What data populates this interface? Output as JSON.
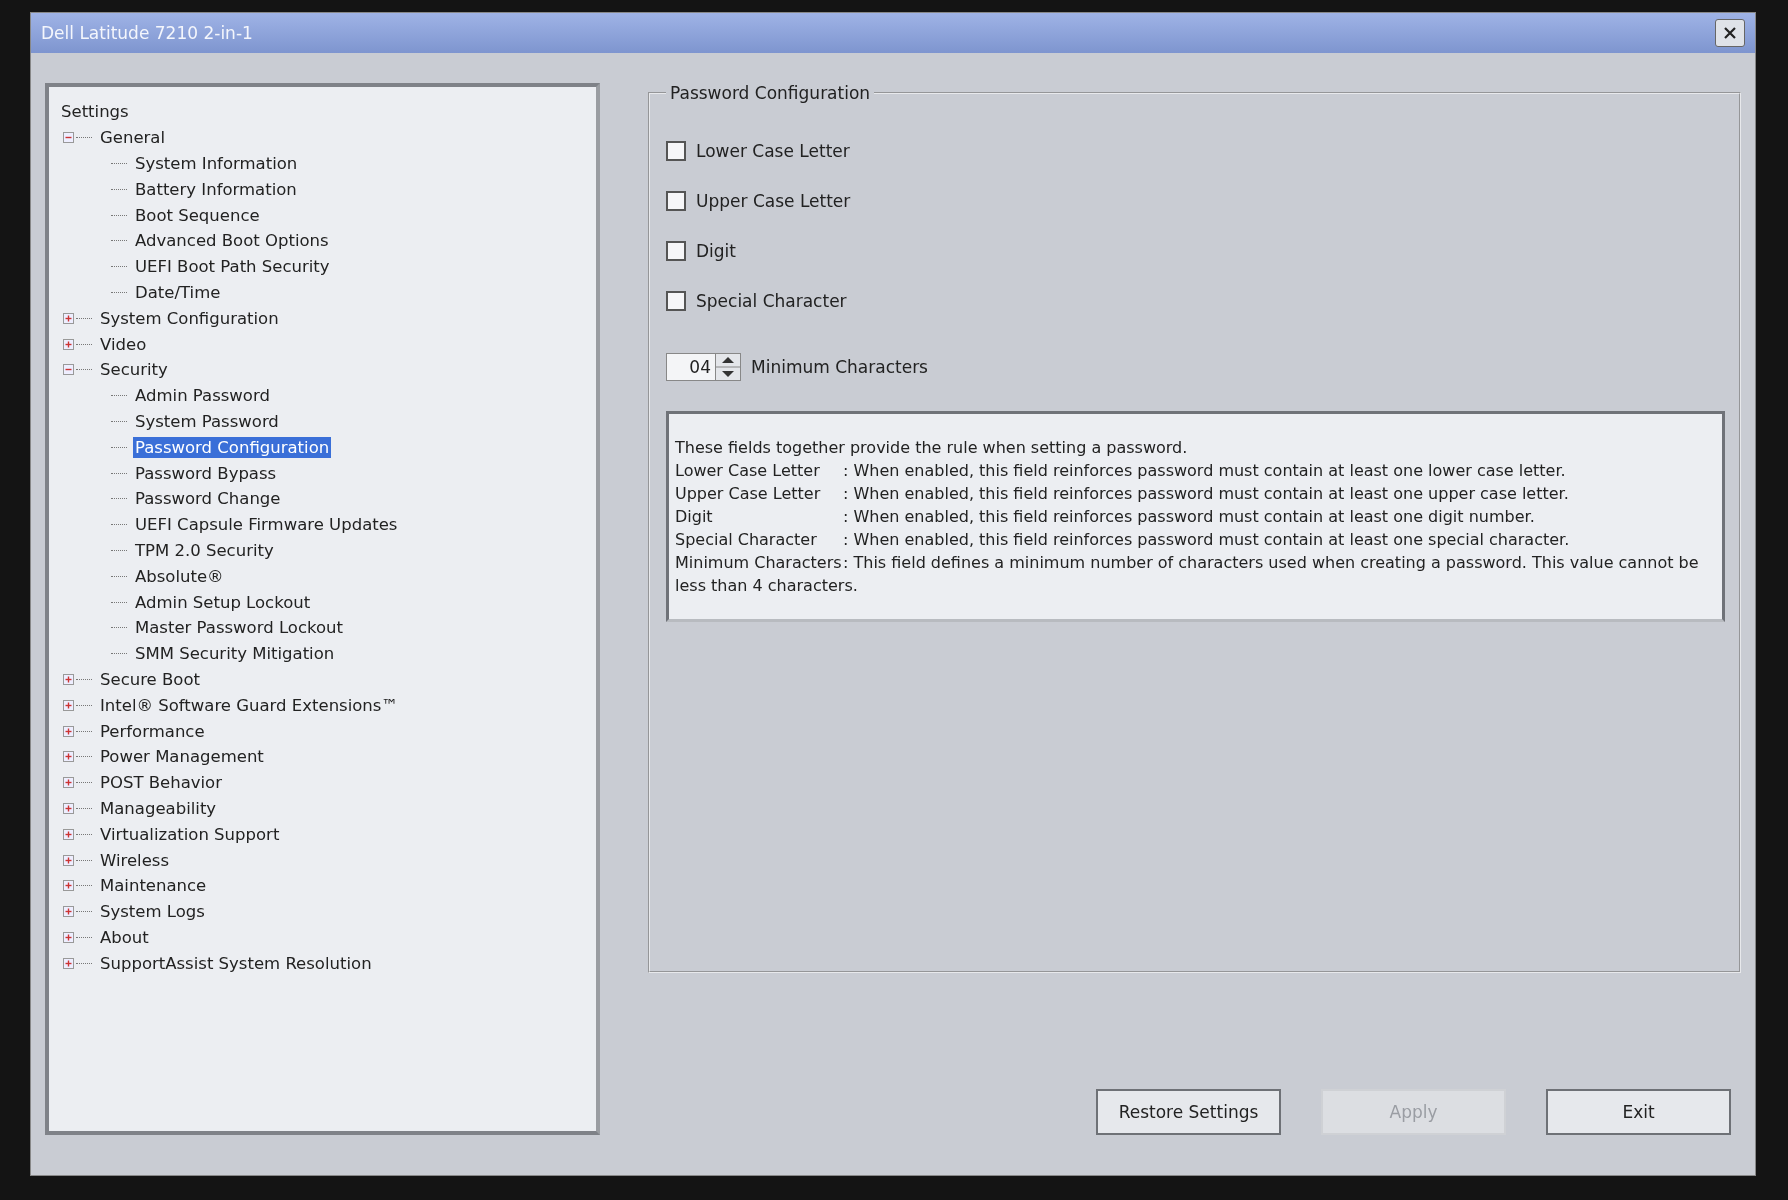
{
  "window": {
    "title": "Dell Latitude 7210 2-in-1"
  },
  "tree": {
    "label": "Settings",
    "selected": false,
    "children": [
      {
        "label": "General",
        "expanded": true,
        "selected": false,
        "children": [
          {
            "label": "System Information",
            "selected": false
          },
          {
            "label": "Battery Information",
            "selected": false
          },
          {
            "label": "Boot Sequence",
            "selected": false
          },
          {
            "label": "Advanced Boot Options",
            "selected": false
          },
          {
            "label": "UEFI Boot Path Security",
            "selected": false
          },
          {
            "label": "Date/Time",
            "selected": false
          }
        ]
      },
      {
        "label": "System Configuration",
        "expanded": false,
        "selected": false
      },
      {
        "label": "Video",
        "expanded": false,
        "selected": false
      },
      {
        "label": "Security",
        "expanded": true,
        "selected": false,
        "children": [
          {
            "label": "Admin Password",
            "selected": false
          },
          {
            "label": "System Password",
            "selected": false
          },
          {
            "label": "Password Configuration",
            "selected": true
          },
          {
            "label": "Password Bypass",
            "selected": false
          },
          {
            "label": "Password Change",
            "selected": false
          },
          {
            "label": "UEFI Capsule Firmware Updates",
            "selected": false
          },
          {
            "label": "TPM 2.0 Security",
            "selected": false
          },
          {
            "label": "Absolute®",
            "selected": false
          },
          {
            "label": "Admin Setup Lockout",
            "selected": false
          },
          {
            "label": "Master Password Lockout",
            "selected": false
          },
          {
            "label": "SMM Security Mitigation",
            "selected": false
          }
        ]
      },
      {
        "label": "Secure Boot",
        "expanded": false,
        "selected": false
      },
      {
        "label": "Intel® Software Guard Extensions™",
        "expanded": false,
        "selected": false
      },
      {
        "label": "Performance",
        "expanded": false,
        "selected": false
      },
      {
        "label": "Power Management",
        "expanded": false,
        "selected": false
      },
      {
        "label": "POST Behavior",
        "expanded": false,
        "selected": false
      },
      {
        "label": "Manageability",
        "expanded": false,
        "selected": false
      },
      {
        "label": "Virtualization Support",
        "expanded": false,
        "selected": false
      },
      {
        "label": "Wireless",
        "expanded": false,
        "selected": false
      },
      {
        "label": "Maintenance",
        "expanded": false,
        "selected": false
      },
      {
        "label": "System Logs",
        "expanded": false,
        "selected": false
      },
      {
        "label": "About",
        "expanded": false,
        "selected": false
      },
      {
        "label": "SupportAssist System Resolution",
        "expanded": false,
        "selected": false
      }
    ]
  },
  "group": {
    "title": "Password Configuration",
    "options": [
      {
        "label": "Lower Case Letter",
        "checked": false
      },
      {
        "label": "Upper Case Letter",
        "checked": false
      },
      {
        "label": "Digit",
        "checked": false
      },
      {
        "label": "Special Character",
        "checked": false
      }
    ],
    "spinner": {
      "value": "04",
      "label": "Minimum Characters"
    },
    "description": {
      "intro": "These fields together provide the rule when setting a password.",
      "rules": [
        {
          "term": "Lower Case Letter",
          "text": ": When enabled, this field reinforces password must contain at least one lower case letter."
        },
        {
          "term": "Upper Case Letter",
          "text": ": When enabled, this field reinforces password must contain at least one upper case letter."
        },
        {
          "term": "Digit",
          "text": ": When enabled, this field reinforces password must contain at least one digit number."
        },
        {
          "term": "Special Character",
          "text": ": When enabled, this field reinforces password must contain at least one special character."
        },
        {
          "term": "Minimum Characters",
          "text": ": This field defines a minimum number of characters used when creating a password. This value cannot be less than 4 characters."
        }
      ]
    }
  },
  "buttons": [
    {
      "label": "Restore Settings",
      "disabled": false
    },
    {
      "label": "Apply",
      "disabled": true
    },
    {
      "label": "Exit",
      "disabled": false
    }
  ]
}
